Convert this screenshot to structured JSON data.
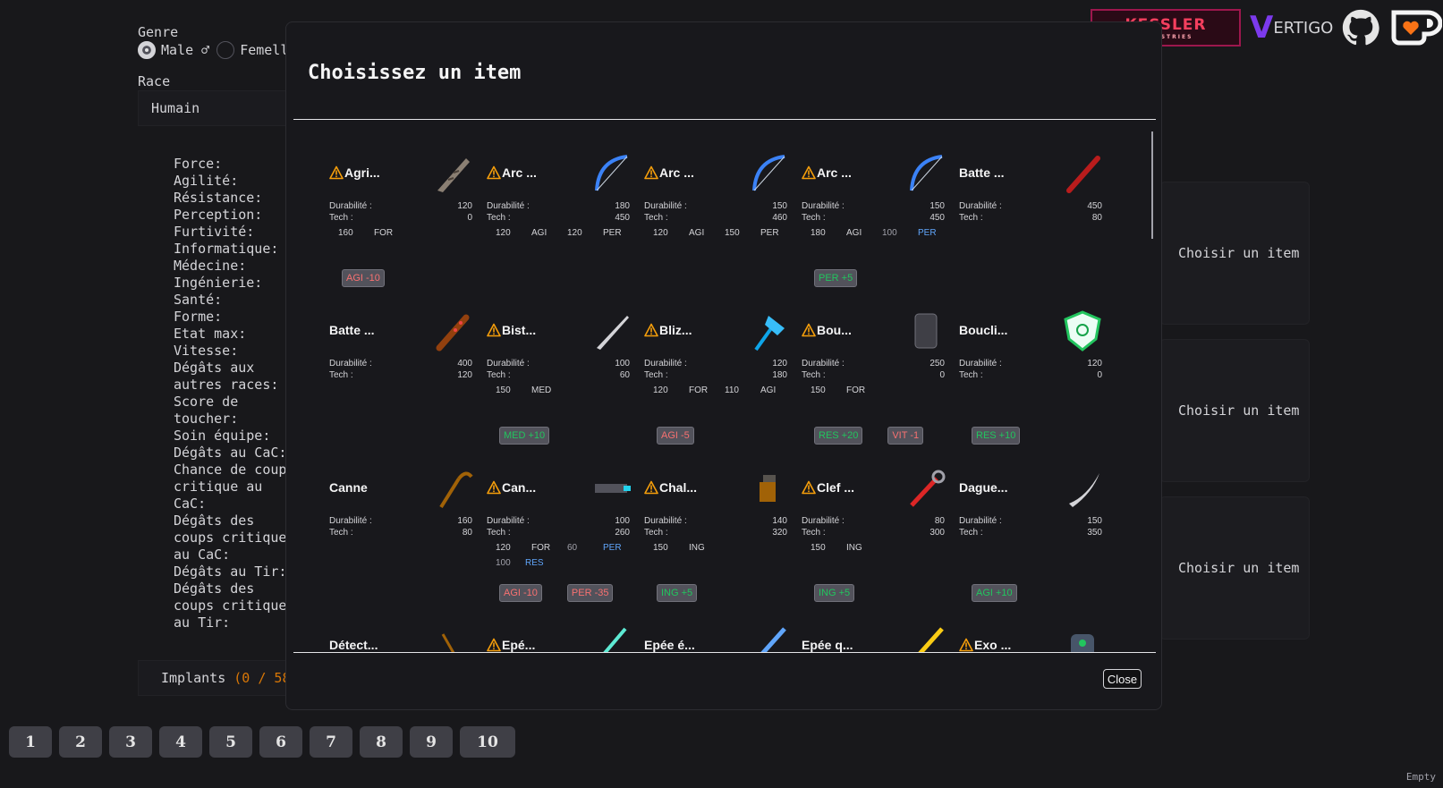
{
  "background": {
    "genre_label": "Genre",
    "gender_options": [
      "Male ♂",
      "Femell"
    ],
    "race_label": "Race",
    "race_value": "Humain",
    "stats": [
      "Force:",
      "Agilité:",
      "Résistance:",
      "Perception:",
      "Furtivité:",
      "Informatique:",
      "Médecine:",
      "Ingénierie:",
      "Santé:",
      "Forme:",
      "Etat max:",
      "Vitesse:",
      "Dégâts aux autres races:",
      "Score de toucher:",
      "Soin équipe:",
      "Dégâts au CaC:",
      "Chance de coup critique au CaC:",
      "Dégâts des coups critique au CaC:",
      "Dégâts au Tir:",
      "Dégâts des coups critique au Tir:"
    ],
    "implants_label": "Implants",
    "implants_count": "(0 / 58",
    "choose_item_label": "Choisir un item",
    "pages": [
      "1",
      "2",
      "3",
      "4",
      "5",
      "6",
      "7",
      "8",
      "9",
      "10"
    ],
    "empty_label": "Empty"
  },
  "logos": {
    "kessler": "KESSLER",
    "kessler_sub": "INDUSTRIES",
    "vertigo_v": "V",
    "vertigo_rest": "ERTIGO"
  },
  "modal": {
    "title": "Choisissez un item",
    "close_label": "Close",
    "dur_label": "Durabilité :",
    "tech_label": "Tech :",
    "items": [
      {
        "name": "Agri...",
        "warn": true,
        "icon": "knife-icon",
        "dur": "120",
        "tech": "0",
        "reqs": [
          [
            "160",
            "FOR",
            ""
          ]
        ],
        "badges": [
          [
            "AGI -10",
            "neg"
          ]
        ]
      },
      {
        "name": "Arc ...",
        "warn": true,
        "icon": "bow-icon",
        "dur": "180",
        "tech": "450",
        "reqs": [
          [
            "120",
            "AGI",
            ""
          ],
          [
            "120",
            "PER",
            ""
          ]
        ],
        "badges": []
      },
      {
        "name": "Arc ...",
        "warn": true,
        "icon": "bow-icon",
        "dur": "150",
        "tech": "460",
        "reqs": [
          [
            "120",
            "AGI",
            ""
          ],
          [
            "150",
            "PER",
            ""
          ]
        ],
        "badges": []
      },
      {
        "name": "Arc ...",
        "warn": true,
        "icon": "bow-icon",
        "dur": "150",
        "tech": "450",
        "reqs": [
          [
            "180",
            "AGI",
            ""
          ],
          [
            "100",
            "PER",
            "blue"
          ]
        ],
        "badges": [
          [
            "PER +5",
            "pos"
          ]
        ]
      },
      {
        "name": "Batte ...",
        "warn": false,
        "icon": "bat-icon",
        "dur": "450",
        "tech": "80",
        "reqs": [],
        "badges": []
      },
      {
        "name": "Batte ...",
        "warn": false,
        "icon": "spiked-bat-icon",
        "dur": "400",
        "tech": "120",
        "reqs": [],
        "badges": []
      },
      {
        "name": "Bist...",
        "warn": true,
        "icon": "blade-icon",
        "dur": "100",
        "tech": "60",
        "reqs": [
          [
            "150",
            "MED",
            ""
          ]
        ],
        "badges": [
          [
            "MED +10",
            "pos"
          ]
        ]
      },
      {
        "name": "Bliz...",
        "warn": true,
        "icon": "axe-icon",
        "dur": "120",
        "tech": "180",
        "reqs": [
          [
            "120",
            "FOR",
            ""
          ],
          [
            "110",
            "AGI",
            ""
          ]
        ],
        "badges": [
          [
            "AGI -5",
            "neg"
          ]
        ]
      },
      {
        "name": "Bou...",
        "warn": true,
        "icon": "shield-icon",
        "dur": "250",
        "tech": "0",
        "reqs": [
          [
            "150",
            "FOR",
            ""
          ]
        ],
        "badges": [
          [
            "RES +20",
            "pos"
          ],
          [
            "VIT -1",
            "neg"
          ]
        ]
      },
      {
        "name": "Boucli...",
        "warn": false,
        "icon": "green-shield-icon",
        "dur": "120",
        "tech": "0",
        "reqs": [],
        "badges": [
          [
            "RES +10",
            "pos"
          ]
        ]
      },
      {
        "name": "Canne",
        "warn": false,
        "icon": "cane-icon",
        "dur": "160",
        "tech": "80",
        "reqs": [],
        "badges": []
      },
      {
        "name": "Can...",
        "warn": true,
        "icon": "gun-icon",
        "dur": "100",
        "tech": "260",
        "reqs": [
          [
            "120",
            "FOR",
            ""
          ],
          [
            "60",
            "PER",
            "blue"
          ],
          [
            "100",
            "RES",
            "blue"
          ]
        ],
        "badges": [
          [
            "AGI -10",
            "neg"
          ],
          [
            "PER -35",
            "neg"
          ]
        ]
      },
      {
        "name": "Chal...",
        "warn": true,
        "icon": "torch-icon",
        "dur": "140",
        "tech": "320",
        "reqs": [
          [
            "150",
            "ING",
            ""
          ]
        ],
        "badges": [
          [
            "ING +5",
            "pos"
          ]
        ]
      },
      {
        "name": "Clef ...",
        "warn": true,
        "icon": "wrench-icon",
        "dur": "80",
        "tech": "300",
        "reqs": [
          [
            "150",
            "ING",
            ""
          ]
        ],
        "badges": [
          [
            "ING +5",
            "pos"
          ]
        ]
      },
      {
        "name": "Dague...",
        "warn": false,
        "icon": "dagger-icon",
        "dur": "150",
        "tech": "350",
        "reqs": [],
        "badges": [
          [
            "AGI +10",
            "pos"
          ]
        ]
      },
      {
        "name": "Détect...",
        "warn": false,
        "icon": "detector-icon",
        "dur": "",
        "tech": "",
        "reqs": [],
        "badges": []
      },
      {
        "name": "Epé...",
        "warn": true,
        "icon": "sword-icon",
        "dur": "",
        "tech": "",
        "reqs": [],
        "badges": []
      },
      {
        "name": "Epée é...",
        "warn": false,
        "icon": "energy-sword-icon",
        "dur": "",
        "tech": "",
        "reqs": [],
        "badges": []
      },
      {
        "name": "Epée q...",
        "warn": false,
        "icon": "quantum-sword-icon",
        "dur": "",
        "tech": "",
        "reqs": [],
        "badges": []
      },
      {
        "name": "Exo ...",
        "warn": true,
        "icon": "exo-glove-icon",
        "dur": "",
        "tech": "",
        "reqs": [],
        "badges": []
      }
    ]
  }
}
